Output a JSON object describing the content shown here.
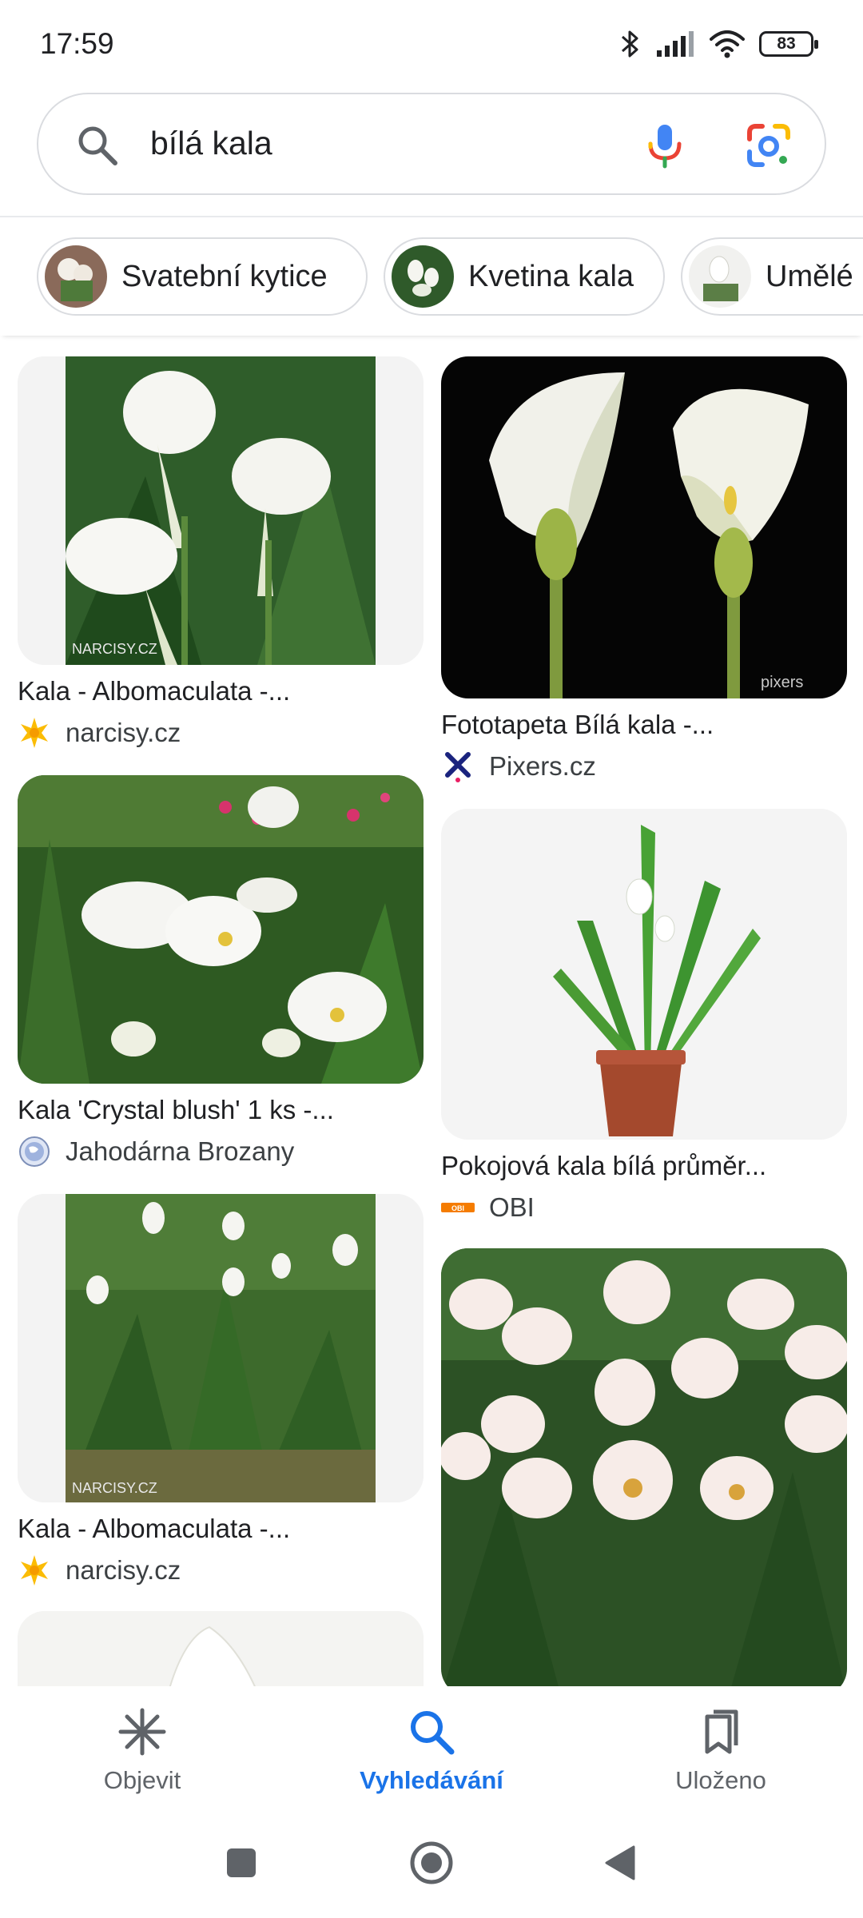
{
  "status_bar": {
    "time": "17:59",
    "battery": "83"
  },
  "search": {
    "query": "bílá kala"
  },
  "chips": [
    {
      "label": "Svatební kytice"
    },
    {
      "label": "Kvetina kala"
    },
    {
      "label": "Umělé l"
    }
  ],
  "results": [
    {
      "title": "Kala - Albomaculata -...",
      "source": "narcisy.cz",
      "watermark": "NARCISY.CZ"
    },
    {
      "title": "Fototapeta Bílá kala -...",
      "source": "Pixers.cz",
      "watermark": "pixers"
    },
    {
      "title": "Kala 'Crystal blush' 1 ks -...",
      "source": "Jahodárna Brozany"
    },
    {
      "title": "Pokojová kala bílá průměr...",
      "source": "OBI",
      "source_logo": "OBI"
    },
    {
      "title": "Kala - Albomaculata -...",
      "source": "narcisy.cz",
      "watermark": "NARCISY.CZ"
    }
  ],
  "bottom_nav": {
    "items": [
      {
        "label": "Objevit"
      },
      {
        "label": "Vyhledávání"
      },
      {
        "label": "Uloženo"
      }
    ]
  },
  "colors": {
    "accent": "#1a73e8",
    "text": "#202124",
    "secondary_text": "#5f6368",
    "border": "#dadce0"
  }
}
